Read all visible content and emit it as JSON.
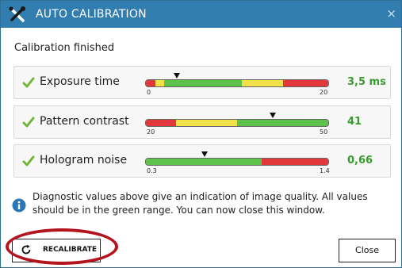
{
  "window": {
    "title": "AUTO CALIBRATION",
    "close_glyph": "×",
    "title_icon": "tools-cross-icon"
  },
  "status_text": "Calibration finished",
  "metrics": [
    {
      "label": "Exposure time",
      "value": "3,5 ms",
      "min_label": "0",
      "max_label": "20",
      "range": [
        0,
        20
      ],
      "marker_value": 3.5,
      "status": "ok",
      "zones": [
        {
          "color": "#e2383b",
          "from": 0,
          "to": 1.0
        },
        {
          "color": "#f0e04a",
          "from": 1.0,
          "to": 2.0
        },
        {
          "color": "#5cc24a",
          "from": 2.0,
          "to": 10.5
        },
        {
          "color": "#f0e04a",
          "from": 10.5,
          "to": 15.0
        },
        {
          "color": "#e2383b",
          "from": 15.0,
          "to": 20
        }
      ]
    },
    {
      "label": "Pattern contrast",
      "value": "41",
      "min_label": "20",
      "max_label": "50",
      "range": [
        20,
        50
      ],
      "marker_value": 41,
      "status": "ok",
      "zones": [
        {
          "color": "#e2383b",
          "from": 20,
          "to": 25
        },
        {
          "color": "#f0e04a",
          "from": 25,
          "to": 35
        },
        {
          "color": "#5cc24a",
          "from": 35,
          "to": 50
        }
      ]
    },
    {
      "label": "Hologram noise",
      "value": "0,66",
      "min_label": "0.3",
      "max_label": "1.4",
      "range": [
        0.3,
        1.4
      ],
      "marker_value": 0.66,
      "status": "ok",
      "zones": [
        {
          "color": "#5cc24a",
          "from": 0.3,
          "to": 1.0
        },
        {
          "color": "#e2383b",
          "from": 1.0,
          "to": 1.4
        }
      ]
    }
  ],
  "info": {
    "text": "Diagnostic values above give an indication of image quality. All values should be in the green range. You can now close this window.",
    "icon": "info-icon"
  },
  "buttons": {
    "recalibrate_label": "RECALIBRATE",
    "recalibrate_icon": "refresh-icon",
    "close_label": "Close"
  },
  "colors": {
    "title_bar": "#317daf",
    "ok_value": "#3a9b2f",
    "check": "#6fb63b",
    "info_icon": "#2b78b8",
    "highlight_ring": "#b3141d"
  }
}
